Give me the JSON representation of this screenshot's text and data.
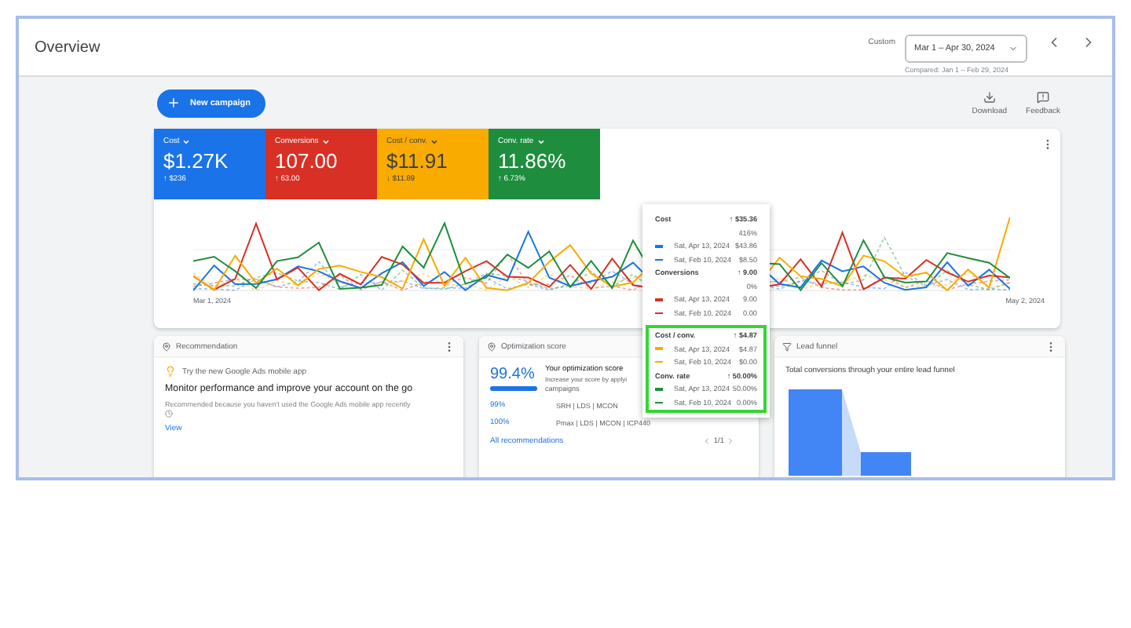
{
  "header": {
    "title": "Overview",
    "date_label": "Custom",
    "date_range": "Mar 1 – Apr 30, 2024",
    "comparison": "Compared: Jan 1 – Feb 29, 2024"
  },
  "toolbar": {
    "new_campaign": "New campaign",
    "actions": [
      {
        "kind": "download",
        "label": "Download"
      },
      {
        "kind": "feedback",
        "label": "Feedback"
      }
    ]
  },
  "metrics": [
    {
      "label": "Cost",
      "value": "$1.27K",
      "change": "↑ $236",
      "color": "#1a73e8"
    },
    {
      "label": "Conversions",
      "value": "107.00",
      "change": "↑ 63.00",
      "color": "#d93025"
    },
    {
      "label": "Cost / conv.",
      "value": "$11.91",
      "change": "↓ $11.89",
      "color": "#f9ab00"
    },
    {
      "label": "Conv. rate",
      "value": "11.86%",
      "change": "↑ 6.73%",
      "color": "#1e8e3e"
    }
  ],
  "chart": {
    "start_label": "Mar 1, 2024",
    "end_label": "May 2, 2024"
  },
  "tooltip": {
    "sections": [
      {
        "title": "Cost",
        "change": "↑ $35.36",
        "percent": "416%",
        "highlighted": false,
        "rows": [
          {
            "date": "Sat, Apr 13, 2024",
            "value": "$43.86",
            "color": "#1a73e8",
            "dashed": false
          },
          {
            "date": "Sat, Feb 10, 2024",
            "value": "$8.50",
            "color": "#1a73e8",
            "dashed": true
          }
        ]
      },
      {
        "title": "Conversions",
        "change": "↑ 9.00",
        "percent": "0%",
        "highlighted": false,
        "rows": [
          {
            "date": "Sat, Apr 13, 2024",
            "value": "9.00",
            "color": "#d93025",
            "dashed": false
          },
          {
            "date": "Sat, Feb 10, 2024",
            "value": "0.00",
            "color": "#d93025",
            "dashed": true
          }
        ]
      },
      {
        "title": "Cost / conv.",
        "change": "↑ $4.87",
        "highlighted": true,
        "rows": [
          {
            "date": "Sat, Apr 13, 2024",
            "value": "$4.87",
            "color": "#f9ab00",
            "dashed": false
          },
          {
            "date": "Sat, Feb 10, 2024",
            "value": "$0.00",
            "color": "#f9ab00",
            "dashed": true
          }
        ]
      },
      {
        "title": "Conv. rate",
        "change": "↑ 50.00%",
        "highlighted": true,
        "rows": [
          {
            "date": "Sat, Apr 13, 2024",
            "value": "50.00%",
            "color": "#1e8e3e",
            "dashed": false
          },
          {
            "date": "Sat, Feb 10, 2024",
            "value": "0.00%",
            "color": "#1e8e3e",
            "dashed": true
          }
        ]
      }
    ]
  },
  "recommendation": {
    "title": "Recommendation",
    "tip": "Try the new Google Ads mobile app",
    "headline": "Monitor performance and improve your account on the go",
    "reason": "Recommended because you haven't used the Google Ads mobile app recently",
    "link": "View"
  },
  "optimization": {
    "title": "Optimization score",
    "score": "99.4%",
    "level": 0.994,
    "heading": "Your optimization score",
    "description": "Increase your score by applyi",
    "note": "campaigns",
    "rows": [
      {
        "score": "99%",
        "campaigns": "SRH | LDS | MCON"
      },
      {
        "score": "100%",
        "campaigns": "Pmax | LDS | MCON | ICP440"
      }
    ],
    "link": "All recommendations",
    "pager": "1/1"
  },
  "funnel": {
    "title": "Lead funnel",
    "description": "Total conversions through your entire lead funnel"
  }
}
